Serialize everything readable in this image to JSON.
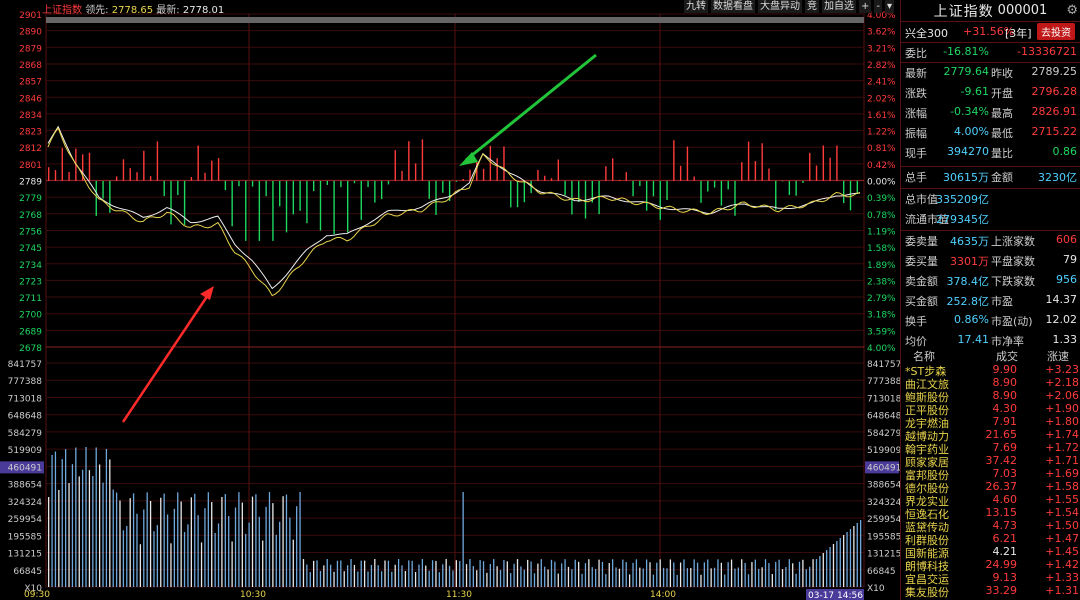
{
  "header": {
    "index_name": "上证指数",
    "lead_label": "领先:",
    "lead_value": "2778.65",
    "latest_label": "最新:",
    "latest_value": "2778.01"
  },
  "toolbar": {
    "items": [
      "九转",
      "数据看盘",
      "大盘异动",
      "竞",
      "加自选",
      "+",
      "-",
      "▾"
    ]
  },
  "price_axis": {
    "left": [
      "2901",
      "2890",
      "2879",
      "2868",
      "2857",
      "2846",
      "2834",
      "2823",
      "2812",
      "2801",
      "2789",
      "2779",
      "2768",
      "2756",
      "2745",
      "2734",
      "2723",
      "2711",
      "2700",
      "2689",
      "2678"
    ],
    "right": [
      "4.00%",
      "3.62%",
      "3.21%",
      "2.82%",
      "2.41%",
      "2.02%",
      "1.61%",
      "1.22%",
      "0.81%",
      "0.42%",
      "0.00%",
      "0.39%",
      "0.78%",
      "1.19%",
      "1.58%",
      "1.89%",
      "2.38%",
      "2.79%",
      "3.18%",
      "3.59%",
      "4.00%"
    ]
  },
  "volume_axis": {
    "left": [
      "841757",
      "777388",
      "713018",
      "648648",
      "584279",
      "519909",
      "460491",
      "388654",
      "324324",
      "259954",
      "195585",
      "131215",
      "66845",
      "X10"
    ],
    "right": [
      "841757",
      "777388",
      "713018",
      "648648",
      "584279",
      "519909",
      "460491",
      "388654",
      "324324",
      "259954",
      "195585",
      "131215",
      "66845",
      "X10"
    ],
    "highlight": "460491"
  },
  "time_axis": [
    "09:30",
    "10:30",
    "11:30",
    "14:00"
  ],
  "time_end_badge": "03-17 14:56",
  "chart_data": {
    "type": "line",
    "prev_close": 2789.25,
    "ylim": [
      2678,
      2901
    ],
    "series_count": 2,
    "x": [
      "09:30",
      "09:45",
      "10:00",
      "10:15",
      "10:30",
      "10:45",
      "11:00",
      "11:15",
      "11:30",
      "13:15",
      "13:30",
      "13:45",
      "14:00",
      "14:15",
      "14:30",
      "14:45",
      "15:00"
    ]
  },
  "panel": {
    "title": "上证指数",
    "code": "000001",
    "promo_name": "兴全300",
    "promo_change": "+31.56%",
    "promo_period": "[3年]",
    "promo_button": "去投资",
    "rows": [
      {
        "l1": "委比",
        "v1": "-16.81%",
        "l2": "",
        "v2": "-13336721"
      },
      {
        "l1": "最新",
        "v1": "2779.64",
        "l2": "昨收",
        "v2": "2789.25"
      },
      {
        "l1": "涨跌",
        "v1": "-9.61",
        "l2": "开盘",
        "v2": "2796.28"
      },
      {
        "l1": "涨幅",
        "v1": "-0.34%",
        "l2": "最高",
        "v2": "2826.91"
      },
      {
        "l1": "振幅",
        "v1": "4.00%",
        "l2": "最低",
        "v2": "2715.22"
      },
      {
        "l1": "现手",
        "v1": "394270",
        "l2": "量比",
        "v2": "0.86"
      },
      {
        "l1": "总手",
        "v1": "30615万",
        "l2": "金额",
        "v2": "3230亿"
      },
      {
        "l1": "总市值",
        "v1": "335209亿",
        "l2": "",
        "v2": ""
      },
      {
        "l1": "流通市值",
        "v1": "279345亿",
        "l2": "",
        "v2": ""
      },
      {
        "l1": "委卖量",
        "v1": "4635万",
        "l2": "上涨家数",
        "v2": "606"
      },
      {
        "l1": "委买量",
        "v1": "3301万",
        "l2": "平盘家数",
        "v2": "79"
      },
      {
        "l1": "卖金额",
        "v1": "378.4亿",
        "l2": "下跌家数",
        "v2": "956"
      },
      {
        "l1": "买金额",
        "v1": "252.8亿",
        "l2": "市盈",
        "v2": "14.37"
      },
      {
        "l1": "换手",
        "v1": "0.86%",
        "l2": "市盈(动)",
        "v2": "12.02"
      },
      {
        "l1": "均价",
        "v1": "17.41",
        "l2": "市净率",
        "v2": "1.33"
      }
    ],
    "list_headers": [
      "名称",
      "成交",
      "涨速"
    ],
    "list": [
      {
        "name": "*ST步森",
        "price": "9.90",
        "speed": "+3.23"
      },
      {
        "name": "曲江文旅",
        "price": "8.90",
        "speed": "+2.18"
      },
      {
        "name": "鲍斯股份",
        "price": "8.90",
        "speed": "+2.06"
      },
      {
        "name": "正平股份",
        "price": "4.30",
        "speed": "+1.90"
      },
      {
        "name": "龙宇燃油",
        "price": "7.91",
        "speed": "+1.80"
      },
      {
        "name": "越博动力",
        "price": "21.65",
        "speed": "+1.74"
      },
      {
        "name": "翰宇药业",
        "price": "7.69",
        "speed": "+1.72"
      },
      {
        "name": "顾家家居",
        "price": "37.42",
        "speed": "+1.71"
      },
      {
        "name": "富邦股份",
        "price": "7.03",
        "speed": "+1.69"
      },
      {
        "name": "德尔股份",
        "price": "26.37",
        "speed": "+1.58"
      },
      {
        "name": "界龙实业",
        "price": "4.60",
        "speed": "+1.55"
      },
      {
        "name": "恒逸石化",
        "price": "13.15",
        "speed": "+1.54"
      },
      {
        "name": "蓝黛传动",
        "price": "4.73",
        "speed": "+1.50"
      },
      {
        "name": "利群股份",
        "price": "6.21",
        "speed": "+1.47"
      },
      {
        "name": "国新能源",
        "price": "4.21",
        "speed": "+1.45"
      },
      {
        "name": "朗博科技",
        "price": "24.99",
        "speed": "+1.42"
      },
      {
        "name": "宜昌交运",
        "price": "9.13",
        "speed": "+1.33"
      },
      {
        "name": "集友股份",
        "price": "33.29",
        "speed": "+1.31"
      }
    ]
  },
  "colors": {
    "up": "#ff3b3b",
    "down": "#1ed760",
    "grid": "#5a1010",
    "price_line": "#f0f0f0",
    "avg_line": "#e8d44d",
    "vol": "#6fa8dc"
  }
}
